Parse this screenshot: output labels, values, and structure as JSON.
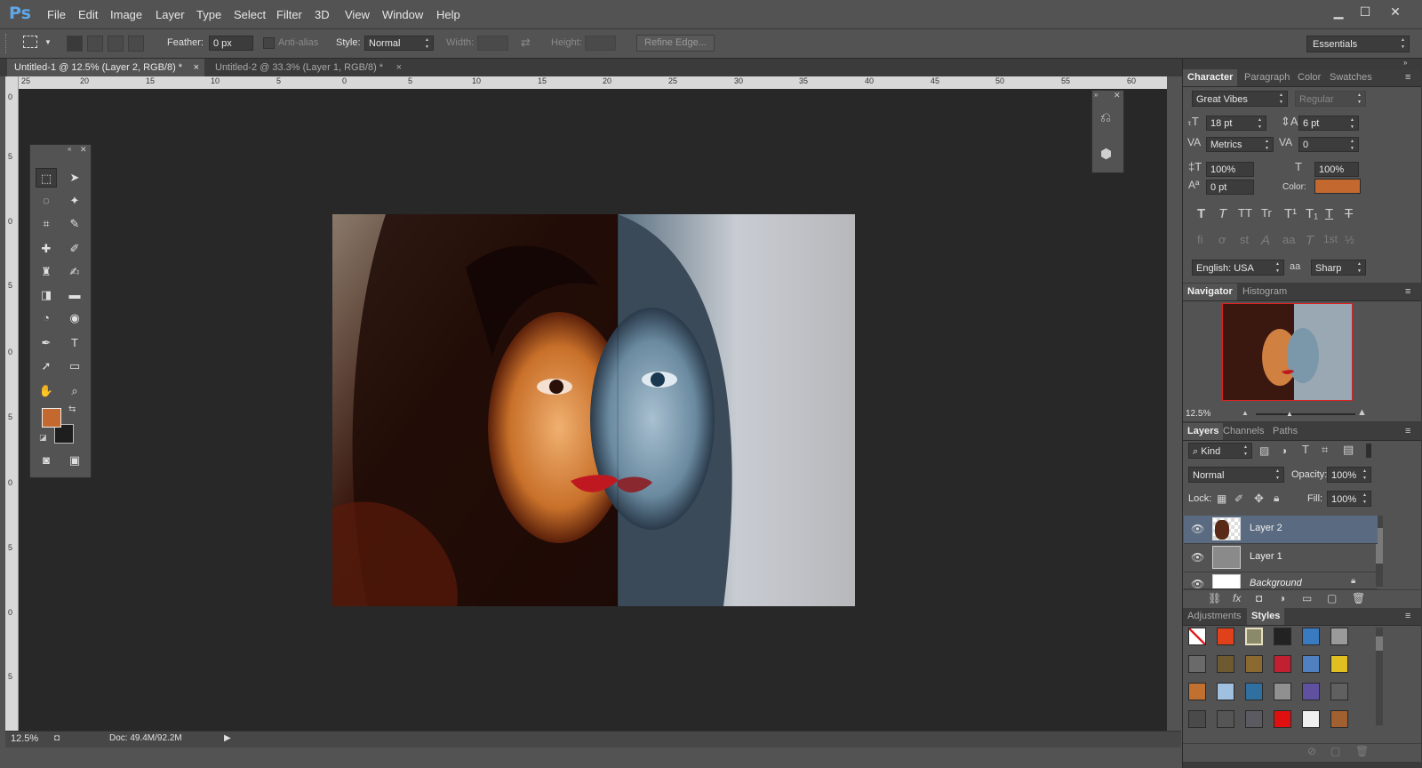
{
  "app": {
    "logo": "Ps"
  },
  "menu": [
    "File",
    "Edit",
    "Image",
    "Layer",
    "Type",
    "Select",
    "Filter",
    "3D",
    "View",
    "Window",
    "Help"
  ],
  "window_controls": {
    "minimize": "▁",
    "maximize": "☐",
    "close": "✕"
  },
  "options": {
    "feather_label": "Feather:",
    "feather_value": "0 px",
    "antialias_label": "Anti-alias",
    "style_label": "Style:",
    "style_value": "Normal",
    "width_label": "Width:",
    "height_label": "Height:",
    "refine_edge": "Refine Edge...",
    "workspace": "Essentials"
  },
  "doc_tabs": [
    {
      "label": "Untitled-1 @ 12.5% (Layer 2, RGB/8) *",
      "close": "×"
    },
    {
      "label": "Untitled-2 @ 33.3% (Layer 1, RGB/8) *",
      "close": "×"
    }
  ],
  "hruler_labels": [
    "25",
    "20",
    "15",
    "10",
    "5",
    "0",
    "5",
    "10",
    "15",
    "20",
    "25",
    "30",
    "35",
    "40",
    "45",
    "50",
    "55",
    "60"
  ],
  "vruler_labels": [
    "0",
    "5",
    "0",
    "5",
    "0",
    "5",
    "0",
    "5",
    "0",
    "5"
  ],
  "status": {
    "zoom": "12.5%",
    "doc": "Doc: 49.4M/92.2M"
  },
  "tools": {
    "rows": [
      [
        "⬚",
        "➤"
      ],
      [
        "◌",
        "✦"
      ],
      [
        "⌗",
        "✎"
      ],
      [
        "✚",
        "✐"
      ],
      [
        "♜",
        "✍"
      ],
      [
        "◨",
        "▬"
      ],
      [
        "◔",
        "◉"
      ],
      [
        "✒",
        "T"
      ],
      [
        "➚",
        "▭"
      ],
      [
        "✋",
        "⌕"
      ]
    ],
    "fg_color": "#c3692f",
    "bg_color": "#1e1e1e"
  },
  "character": {
    "tabs": [
      "Character",
      "Paragraph",
      "Color",
      "Swatches"
    ],
    "font_family": "Great Vibes",
    "font_style": "Regular",
    "size": "18 pt",
    "leading": "6 pt",
    "kerning": "Metrics",
    "tracking": "0",
    "vscale": "100%",
    "hscale": "100%",
    "baseline": "0 pt",
    "color_label": "Color:",
    "color": "#c3692f",
    "style_buttons": [
      "T",
      "T",
      "TT",
      "Tr",
      "T¹",
      "T₁",
      "T",
      "T"
    ],
    "opentype_buttons": [
      "fi",
      "ơ",
      "st",
      "A",
      "aa",
      "T",
      "1st",
      "½"
    ],
    "language": "English: USA",
    "aa_label": "aa",
    "antialias": "Sharp"
  },
  "navigator": {
    "tabs": [
      "Navigator",
      "Histogram"
    ],
    "zoom": "12.5%"
  },
  "layers": {
    "tabs": [
      "Layers",
      "Channels",
      "Paths"
    ],
    "filter": "Kind",
    "blend_mode": "Normal",
    "opacity_label": "Opacity:",
    "opacity": "100%",
    "lock_label": "Lock:",
    "fill_label": "Fill:",
    "fill": "100%",
    "items": [
      {
        "name": "Layer 2",
        "selected": true
      },
      {
        "name": "Layer 1",
        "selected": false
      },
      {
        "name": "Background",
        "selected": false
      }
    ],
    "footer_icons": [
      "⛓",
      "fx",
      "◘",
      "◑",
      "▭",
      "▢",
      "🗑"
    ]
  },
  "styles": {
    "tabs": [
      "Adjustments",
      "Styles"
    ],
    "swatches": [
      "#ffffff",
      "#e0401a",
      "#8a8a6a",
      "#222222",
      "#3a7ac0",
      "#9a9a9a",
      "#6a6a6a",
      "#6e5a30",
      "#8a6a30",
      "#c02030",
      "#5080c0",
      "#e0c020",
      "#c07030",
      "#a0c0e0",
      "#3070a0",
      "#909090",
      "#6050a0",
      "#606060",
      "#4a4a4a",
      "#555555",
      "#5a5a60",
      "#e01010",
      "#f0f0f0",
      "#a06030"
    ]
  }
}
